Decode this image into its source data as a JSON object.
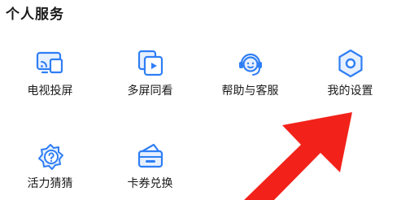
{
  "section": {
    "title": "个人服务"
  },
  "tiles": [
    {
      "label": "电视投屏",
      "icon": "tv-cast-icon"
    },
    {
      "label": "多屏同看",
      "icon": "multi-screen-icon"
    },
    {
      "label": "帮助与客服",
      "icon": "customer-service-icon"
    },
    {
      "label": "我的设置",
      "icon": "settings-icon"
    },
    {
      "label": "活力猜猜",
      "icon": "guess-quiz-icon"
    },
    {
      "label": "卡券兑换",
      "icon": "coupon-wallet-icon"
    }
  ],
  "colors": {
    "icon_blue": "#2f7ef5",
    "icon_fill": "#e6f0ff",
    "arrow_red": "#f2221a"
  }
}
